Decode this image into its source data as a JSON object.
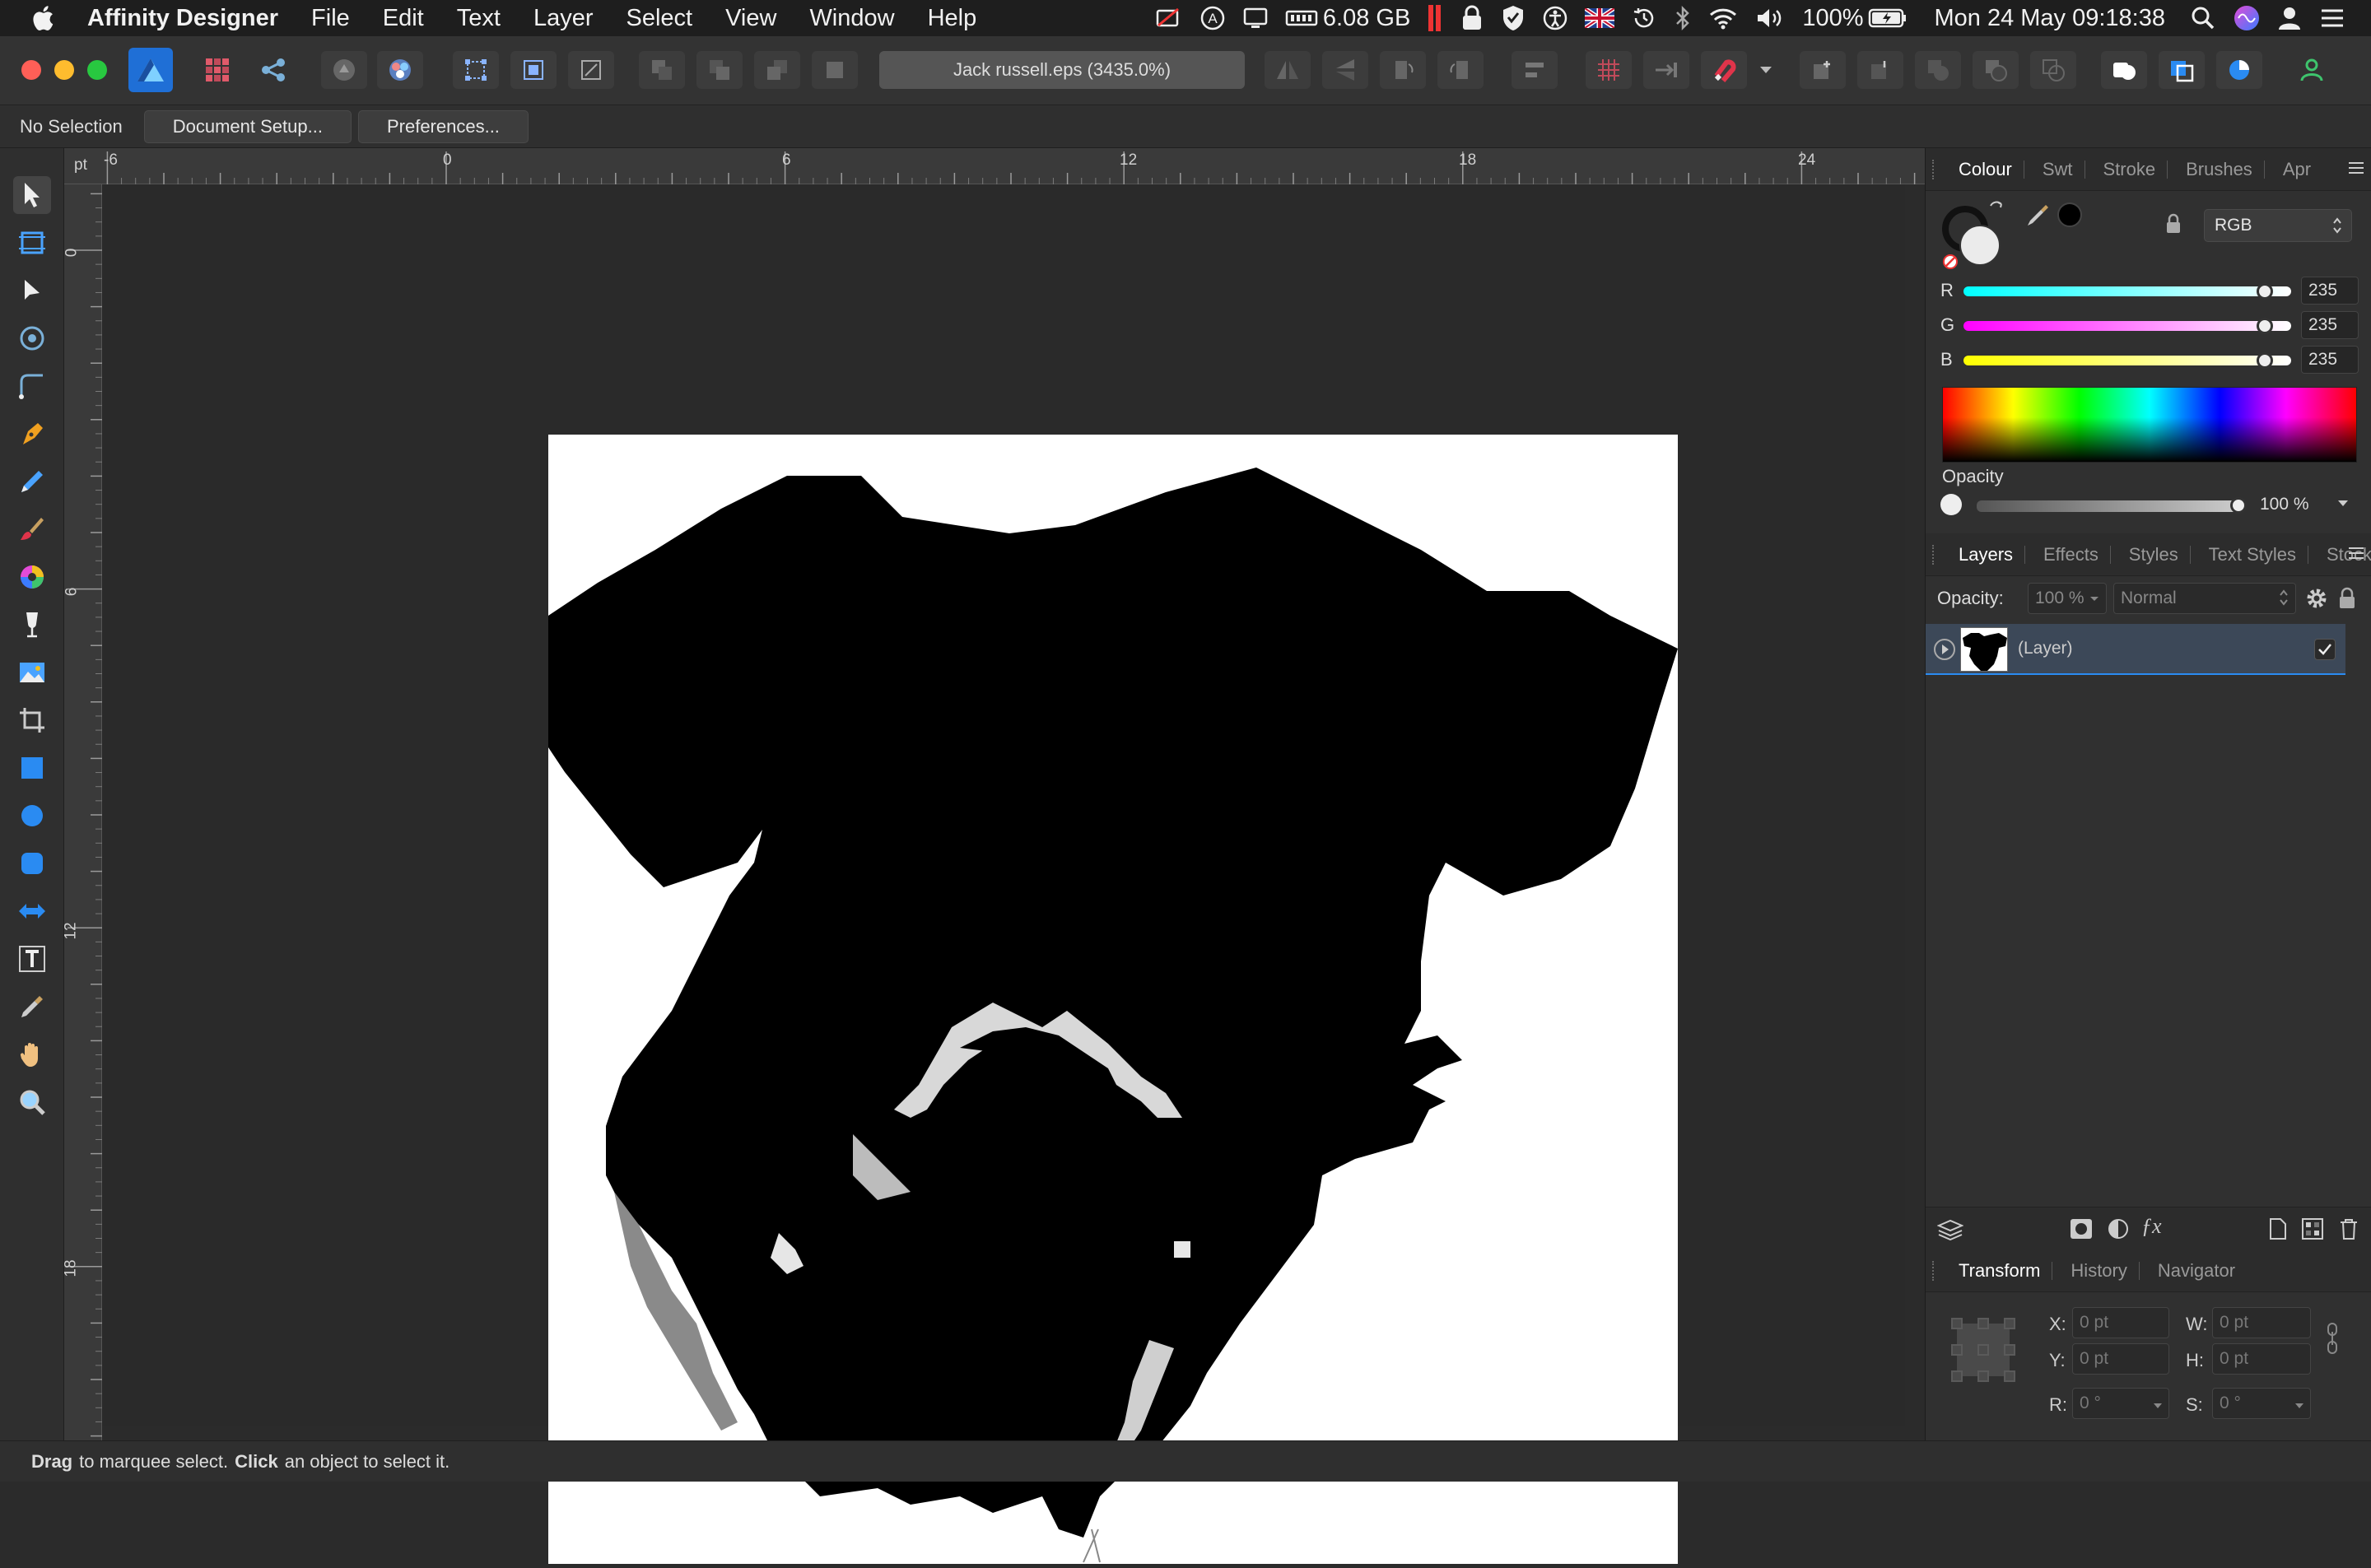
{
  "menubar": {
    "app_name": "Affinity Designer",
    "menus": [
      "File",
      "Edit",
      "Text",
      "Layer",
      "Select",
      "View",
      "Window",
      "Help"
    ],
    "memory": "6.08 GB",
    "battery": "100%",
    "datetime": "Mon 24 May  09:18:38"
  },
  "window": {
    "document_title": "Jack russell.eps (3435.0%)"
  },
  "context_toolbar": {
    "selection_label": "No Selection",
    "document_setup": "Document Setup...",
    "preferences": "Preferences..."
  },
  "ruler": {
    "unit": "pt",
    "top_ticks": [
      "-6",
      "0",
      "6",
      "12",
      "18",
      "24"
    ],
    "left_ticks": [
      "0",
      "6",
      "12",
      "18"
    ]
  },
  "colour_panel": {
    "tabs": [
      "Colour",
      "Swt",
      "Stroke",
      "Brushes",
      "Apr"
    ],
    "model": "RGB",
    "r_label": "R",
    "r_value": "235",
    "r_level": 0.92,
    "g_label": "G",
    "g_value": "235",
    "g_level": 0.92,
    "b_label": "B",
    "b_value": "235",
    "b_level": 0.92,
    "opacity_label": "Opacity",
    "opacity_value": "100 %",
    "opacity_level": 1.0
  },
  "layers_panel": {
    "tabs": [
      "Layers",
      "Effects",
      "Styles",
      "Text Styles",
      "Stock"
    ],
    "opacity_label": "Opacity:",
    "opacity_value": "100 %",
    "blend_mode": "Normal",
    "layers": [
      {
        "name": "(Layer)",
        "visible": true
      }
    ]
  },
  "transform_panel": {
    "tabs": [
      "Transform",
      "History",
      "Navigator"
    ],
    "x_label": "X:",
    "x_value": "0 pt",
    "y_label": "Y:",
    "y_value": "0 pt",
    "w_label": "W:",
    "w_value": "0 pt",
    "h_label": "H:",
    "h_value": "0 pt",
    "r_label": "R:",
    "r_value": "0 °",
    "s_label": "S:",
    "s_value": "0 °"
  },
  "statusbar": {
    "drag_bold": "Drag",
    "drag_text": "to marquee select.",
    "click_bold": "Click",
    "click_text": "an object to select it."
  },
  "colors": {
    "accent": "#2a8bf2",
    "close": "#ff5f57",
    "minimize": "#febc2e",
    "maximize": "#28c840"
  }
}
